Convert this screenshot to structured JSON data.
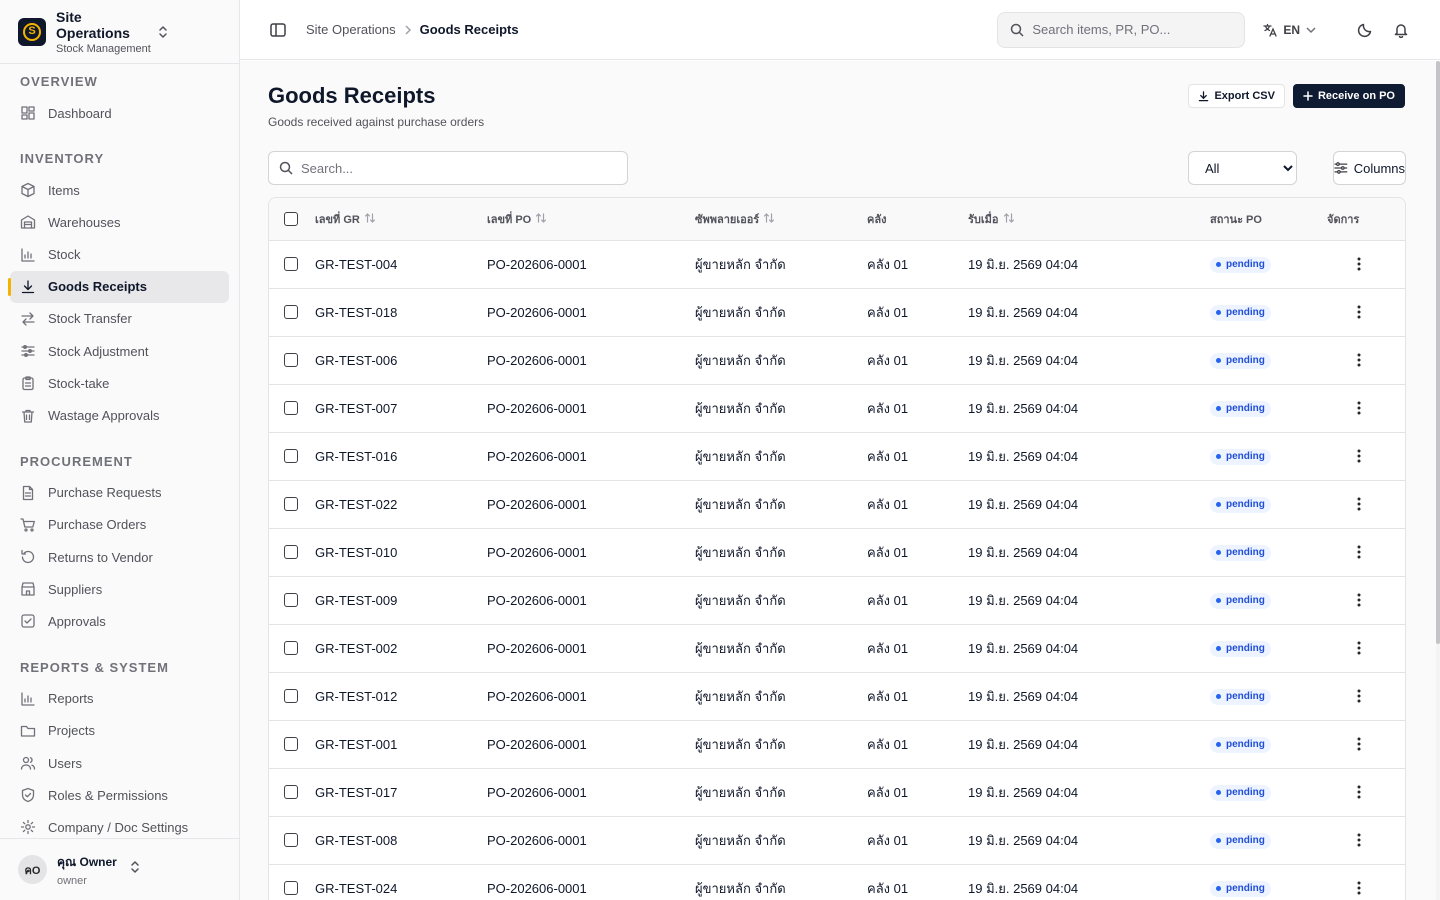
{
  "app": {
    "name": "Site Operations",
    "subtitle": "Stock Management"
  },
  "sidebar": {
    "sections": [
      {
        "title": "OVERVIEW",
        "items": [
          {
            "label": "Dashboard",
            "icon": "dashboard-icon"
          }
        ]
      },
      {
        "title": "INVENTORY",
        "items": [
          {
            "label": "Items",
            "icon": "box-icon"
          },
          {
            "label": "Warehouses",
            "icon": "warehouse-icon"
          },
          {
            "label": "Stock",
            "icon": "bar-chart-icon"
          },
          {
            "label": "Goods Receipts",
            "icon": "download-icon",
            "active": true
          },
          {
            "label": "Stock Transfer",
            "icon": "transfer-icon"
          },
          {
            "label": "Stock Adjustment",
            "icon": "sliders-icon"
          },
          {
            "label": "Stock-take",
            "icon": "clipboard-icon"
          },
          {
            "label": "Wastage Approvals",
            "icon": "trash-icon"
          }
        ]
      },
      {
        "title": "PROCUREMENT",
        "items": [
          {
            "label": "Purchase Requests",
            "icon": "file-icon"
          },
          {
            "label": "Purchase Orders",
            "icon": "cart-icon"
          },
          {
            "label": "Returns to Vendor",
            "icon": "rotate-icon"
          },
          {
            "label": "Suppliers",
            "icon": "store-icon"
          },
          {
            "label": "Approvals",
            "icon": "check-square-icon"
          }
        ]
      },
      {
        "title": "REPORTS & SYSTEM",
        "items": [
          {
            "label": "Reports",
            "icon": "bar-chart-icon"
          },
          {
            "label": "Projects",
            "icon": "folder-icon"
          },
          {
            "label": "Users",
            "icon": "users-icon"
          },
          {
            "label": "Roles & Permissions",
            "icon": "shield-icon"
          },
          {
            "label": "Company / Doc Settings",
            "icon": "gear-icon"
          }
        ]
      }
    ]
  },
  "user": {
    "initials": "คO",
    "name": "คุณ Owner",
    "role": "owner"
  },
  "topbar": {
    "breadcrumb_parent": "Site Operations",
    "breadcrumb_current": "Goods Receipts",
    "search_placeholder": "Search items, PR, PO...",
    "language": "EN"
  },
  "page": {
    "title": "Goods Receipts",
    "subtitle": "Goods received against purchase orders",
    "export_label": "Export CSV",
    "receive_label": "Receive on PO",
    "search_placeholder": "Search...",
    "filter_value": "All",
    "columns_label": "Columns"
  },
  "table": {
    "headers": {
      "gr": "เลขที่ GR",
      "po": "เลขที่ PO",
      "supplier": "ซัพพลายเออร์",
      "warehouse": "คลัง",
      "received": "รับเมื่อ",
      "status": "สถานะ PO",
      "actions": "จัดการ"
    },
    "rows": [
      {
        "gr": "GR-TEST-004",
        "po": "PO-202606-0001",
        "supplier": "ผู้ขายหลัก จำกัด",
        "warehouse": "คลัง 01",
        "received": "19 มิ.ย. 2569 04:04",
        "status": "pending"
      },
      {
        "gr": "GR-TEST-018",
        "po": "PO-202606-0001",
        "supplier": "ผู้ขายหลัก จำกัด",
        "warehouse": "คลัง 01",
        "received": "19 มิ.ย. 2569 04:04",
        "status": "pending"
      },
      {
        "gr": "GR-TEST-006",
        "po": "PO-202606-0001",
        "supplier": "ผู้ขายหลัก จำกัด",
        "warehouse": "คลัง 01",
        "received": "19 มิ.ย. 2569 04:04",
        "status": "pending"
      },
      {
        "gr": "GR-TEST-007",
        "po": "PO-202606-0001",
        "supplier": "ผู้ขายหลัก จำกัด",
        "warehouse": "คลัง 01",
        "received": "19 มิ.ย. 2569 04:04",
        "status": "pending"
      },
      {
        "gr": "GR-TEST-016",
        "po": "PO-202606-0001",
        "supplier": "ผู้ขายหลัก จำกัด",
        "warehouse": "คลัง 01",
        "received": "19 มิ.ย. 2569 04:04",
        "status": "pending"
      },
      {
        "gr": "GR-TEST-022",
        "po": "PO-202606-0001",
        "supplier": "ผู้ขายหลัก จำกัด",
        "warehouse": "คลัง 01",
        "received": "19 มิ.ย. 2569 04:04",
        "status": "pending"
      },
      {
        "gr": "GR-TEST-010",
        "po": "PO-202606-0001",
        "supplier": "ผู้ขายหลัก จำกัด",
        "warehouse": "คลัง 01",
        "received": "19 มิ.ย. 2569 04:04",
        "status": "pending"
      },
      {
        "gr": "GR-TEST-009",
        "po": "PO-202606-0001",
        "supplier": "ผู้ขายหลัก จำกัด",
        "warehouse": "คลัง 01",
        "received": "19 มิ.ย. 2569 04:04",
        "status": "pending"
      },
      {
        "gr": "GR-TEST-002",
        "po": "PO-202606-0001",
        "supplier": "ผู้ขายหลัก จำกัด",
        "warehouse": "คลัง 01",
        "received": "19 มิ.ย. 2569 04:04",
        "status": "pending"
      },
      {
        "gr": "GR-TEST-012",
        "po": "PO-202606-0001",
        "supplier": "ผู้ขายหลัก จำกัด",
        "warehouse": "คลัง 01",
        "received": "19 มิ.ย. 2569 04:04",
        "status": "pending"
      },
      {
        "gr": "GR-TEST-001",
        "po": "PO-202606-0001",
        "supplier": "ผู้ขายหลัก จำกัด",
        "warehouse": "คลัง 01",
        "received": "19 มิ.ย. 2569 04:04",
        "status": "pending"
      },
      {
        "gr": "GR-TEST-017",
        "po": "PO-202606-0001",
        "supplier": "ผู้ขายหลัก จำกัด",
        "warehouse": "คลัง 01",
        "received": "19 มิ.ย. 2569 04:04",
        "status": "pending"
      },
      {
        "gr": "GR-TEST-008",
        "po": "PO-202606-0001",
        "supplier": "ผู้ขายหลัก จำกัด",
        "warehouse": "คลัง 01",
        "received": "19 มิ.ย. 2569 04:04",
        "status": "pending"
      },
      {
        "gr": "GR-TEST-024",
        "po": "PO-202606-0001",
        "supplier": "ผู้ขายหลัก จำกัด",
        "warehouse": "คลัง 01",
        "received": "19 มิ.ย. 2569 04:04",
        "status": "pending"
      }
    ]
  },
  "colors": {
    "brand_dark": "#0f172a",
    "brand_accent": "#f5b301",
    "primary_button": "#0f1b33",
    "status_pending": "#2563eb"
  }
}
